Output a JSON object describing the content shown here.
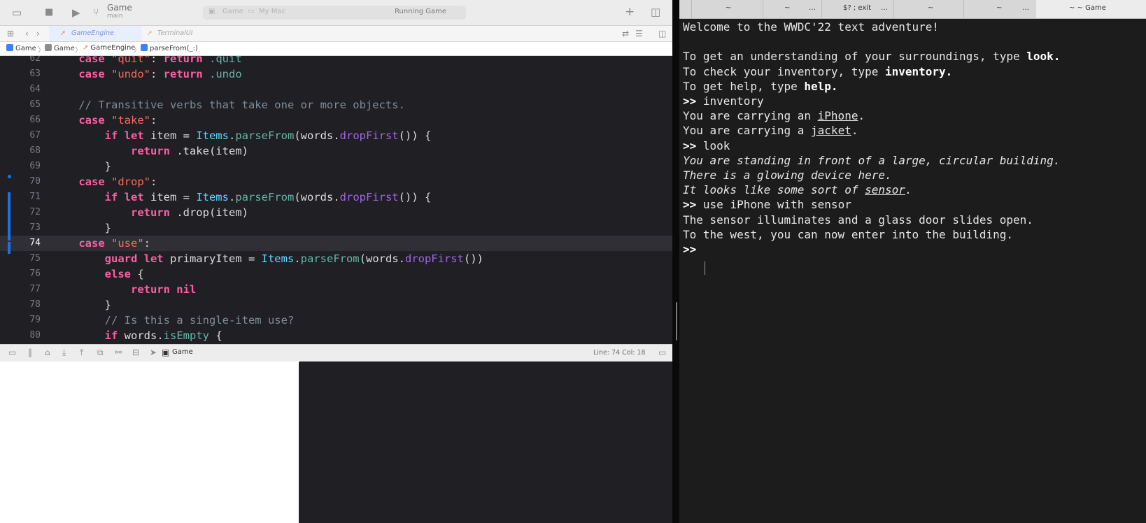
{
  "xcode": {
    "scheme": {
      "title": "Game",
      "subtitle": "main"
    },
    "activity": {
      "destination": "Game",
      "device": "My Mac",
      "status": "Running Game"
    },
    "tabs": [
      {
        "label": "GameEngine"
      },
      {
        "label": "TerminalUI"
      }
    ],
    "breadcrumb": [
      "Game",
      "Game",
      "GameEngine",
      "parseFrom(_:)"
    ],
    "editor": {
      "current_line": 74,
      "lines": [
        {
          "n": "62",
          "tokens": [
            [
              "    ",
              ""
            ],
            [
              "case ",
              "kw"
            ],
            [
              "\"quit\"",
              "str"
            ],
            [
              ": ",
              ""
            ],
            [
              "return ",
              "kw"
            ],
            [
              ".quit",
              "mem"
            ]
          ]
        },
        {
          "n": "63",
          "tokens": [
            [
              "    ",
              ""
            ],
            [
              "case ",
              "kw"
            ],
            [
              "\"undo\"",
              "str"
            ],
            [
              ": ",
              ""
            ],
            [
              "return ",
              "kw"
            ],
            [
              ".undo",
              "mem"
            ]
          ]
        },
        {
          "n": "64",
          "tokens": [
            [
              "",
              ""
            ]
          ]
        },
        {
          "n": "65",
          "tokens": [
            [
              "    ",
              ""
            ],
            [
              "// Transitive verbs that take one or more objects.",
              "cm"
            ]
          ]
        },
        {
          "n": "66",
          "tokens": [
            [
              "    ",
              ""
            ],
            [
              "case ",
              "kw"
            ],
            [
              "\"take\"",
              "str"
            ],
            [
              ":",
              ""
            ]
          ]
        },
        {
          "n": "67",
          "tokens": [
            [
              "        ",
              ""
            ],
            [
              "if let ",
              "kw"
            ],
            [
              "item = ",
              ""
            ],
            [
              "Items",
              "ty"
            ],
            [
              ".",
              ""
            ],
            [
              "parseFrom",
              "fn2"
            ],
            [
              "(words.",
              ""
            ],
            [
              "dropFirst",
              "fn"
            ],
            [
              "()) {",
              ""
            ]
          ]
        },
        {
          "n": "68",
          "tokens": [
            [
              "            ",
              ""
            ],
            [
              "return ",
              "kw"
            ],
            [
              ".take(item)",
              ""
            ]
          ]
        },
        {
          "n": "69",
          "tokens": [
            [
              "        }",
              ""
            ]
          ]
        },
        {
          "n": "70",
          "tokens": [
            [
              "    ",
              ""
            ],
            [
              "case ",
              "kw"
            ],
            [
              "\"drop\"",
              "str"
            ],
            [
              ":",
              ""
            ]
          ]
        },
        {
          "n": "71",
          "tokens": [
            [
              "        ",
              ""
            ],
            [
              "if let ",
              "kw"
            ],
            [
              "item = ",
              ""
            ],
            [
              "Items",
              "ty"
            ],
            [
              ".",
              ""
            ],
            [
              "parseFrom",
              "fn2"
            ],
            [
              "(words.",
              ""
            ],
            [
              "dropFirst",
              "fn"
            ],
            [
              "()) {",
              ""
            ]
          ]
        },
        {
          "n": "72",
          "tokens": [
            [
              "            ",
              ""
            ],
            [
              "return ",
              "kw"
            ],
            [
              ".drop(item)",
              ""
            ]
          ]
        },
        {
          "n": "73",
          "tokens": [
            [
              "        }",
              ""
            ]
          ]
        },
        {
          "n": "74",
          "tokens": [
            [
              "    ",
              ""
            ],
            [
              "case ",
              "kw"
            ],
            [
              "\"use\"",
              "str"
            ],
            [
              ":",
              ""
            ]
          ]
        },
        {
          "n": "75",
          "tokens": [
            [
              "        ",
              ""
            ],
            [
              "guard let ",
              "kw"
            ],
            [
              "primaryItem = ",
              ""
            ],
            [
              "Items",
              "ty"
            ],
            [
              ".",
              ""
            ],
            [
              "parseFrom",
              "fn2"
            ],
            [
              "(words.",
              ""
            ],
            [
              "dropFirst",
              "fn"
            ],
            [
              "())",
              ""
            ]
          ]
        },
        {
          "n": "76",
          "tokens": [
            [
              "        ",
              ""
            ],
            [
              "else ",
              "kw"
            ],
            [
              "{",
              ""
            ]
          ]
        },
        {
          "n": "77",
          "tokens": [
            [
              "            ",
              ""
            ],
            [
              "return nil",
              "kw"
            ]
          ]
        },
        {
          "n": "78",
          "tokens": [
            [
              "        }",
              ""
            ]
          ]
        },
        {
          "n": "79",
          "tokens": [
            [
              "        ",
              ""
            ],
            [
              "// Is this a single-item use?",
              "cm"
            ]
          ]
        },
        {
          "n": "80",
          "tokens": [
            [
              "        ",
              ""
            ],
            [
              "if ",
              "kw"
            ],
            [
              "words.",
              ""
            ],
            [
              "isEmpty",
              "mem"
            ],
            [
              " {",
              ""
            ]
          ]
        }
      ]
    },
    "debug": {
      "target": "Game",
      "position": "Line: 74  Col: 18"
    }
  },
  "terminal": {
    "tabs": [
      {
        "label": ""
      },
      {
        "label": "~"
      },
      {
        "label": "~"
      },
      {
        "label": "$? ; exit"
      },
      {
        "label": "~"
      },
      {
        "label": "~"
      },
      {
        "label": "~ ~ Game"
      }
    ],
    "lines": [
      [
        [
          "Welcome to the WWDC'22 text adventure!",
          ""
        ]
      ],
      [
        [
          "",
          ""
        ]
      ],
      [
        [
          "To get an understanding of your surroundings, type ",
          ""
        ],
        [
          "look.",
          "b"
        ]
      ],
      [
        [
          "To check your inventory, type ",
          ""
        ],
        [
          "inventory.",
          "b"
        ]
      ],
      [
        [
          "To get help, type ",
          ""
        ],
        [
          "help.",
          "b"
        ]
      ],
      [
        [
          ">> ",
          "b"
        ],
        [
          "inventory",
          ""
        ]
      ],
      [
        [
          "You are carrying an ",
          ""
        ],
        [
          "iPhone",
          "u"
        ],
        [
          ".",
          ""
        ]
      ],
      [
        [
          "You are carrying a ",
          ""
        ],
        [
          "jacket",
          "u"
        ],
        [
          ".",
          ""
        ]
      ],
      [
        [
          ">> ",
          "b"
        ],
        [
          "look",
          ""
        ]
      ],
      [
        [
          "You are standing in front of a large, circular building.",
          "i"
        ]
      ],
      [
        [
          "There is a glowing device here.",
          "i"
        ]
      ],
      [
        [
          "It looks like some sort of ",
          "i"
        ],
        [
          "sensor",
          "i u"
        ],
        [
          ".",
          "i"
        ]
      ],
      [
        [
          ">> ",
          "b"
        ],
        [
          "use iPhone with sensor",
          ""
        ]
      ],
      [
        [
          "The sensor illuminates and a glass door slides open.",
          ""
        ]
      ],
      [
        [
          "To the west, you can now enter into the building.",
          ""
        ]
      ],
      [
        [
          ">> ",
          "b"
        ]
      ]
    ]
  }
}
